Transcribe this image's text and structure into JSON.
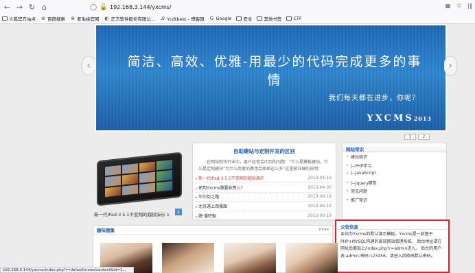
{
  "browser": {
    "url": "192.168.3.144/yxcms/",
    "bookmarks": [
      "火狐官方站点",
      "百度搜索",
      "老毛桃官网",
      "正方软件股份有限公...",
      "Ycdtbest - 博客园",
      "Google",
      "安全",
      "其他书签",
      "CTF"
    ],
    "status_url": "192.168.3.144/yxcms/index.php?r=default/news/content&id=1..."
  },
  "banner": {
    "title": "简洁、高效、优雅-用最少的代码完成更多的事情",
    "subtitle": "我们每天都在进步，你呢？",
    "logo": "YXCMS",
    "logo_year": "2013"
  },
  "pager": [
    "1",
    "2"
  ],
  "tablet": {
    "caption": "新一代iPad 3 5.1不变翔的越狱演示 1",
    "num": "2"
  },
  "news": {
    "title": "自助建站与定制开发的区别",
    "desc": "在网站制作行业中，客户经常会问到的问题：“什么是模板建站，什么是定制建站”为什么两者的费用会相差这么多”这里做详细的说明：",
    "items": [
      {
        "title": "新一代iPad 3 5.1不变翔的越狱演示",
        "date": "2013-04-19",
        "red": true
      },
      {
        "title": "使用Yxcms需要收费么?",
        "date": "2013-04-30",
        "red": false
      },
      {
        "title": "华尔街之路",
        "date": "2013-06-19",
        "red": false
      },
      {
        "title": "北京遇上西雅图",
        "date": "2013-06-19",
        "red": false
      },
      {
        "title": "臆·潘旺魁",
        "date": "2013-06-19",
        "red": false
      }
    ]
  },
  "side": {
    "title": "网站常识",
    "items": [
      "建站知识",
      "|--PHP学习",
      "|--JavaScript",
      "|--Jquery精萃",
      "常见问题",
      "推广常识"
    ]
  },
  "notice": {
    "title": "公告信息",
    "body": "本站为Yxcms的默认演示模板，Yxcms是一款基于PHP+MYSQL构建的高效网站管理系统。 后台地址请在网址后面加上/index.php?r=admin进入。 后台的用户名:admin;密码:123456，请进入后修改默认密码。"
  },
  "gallery": {
    "title": "趣味图集",
    "more": "more"
  }
}
